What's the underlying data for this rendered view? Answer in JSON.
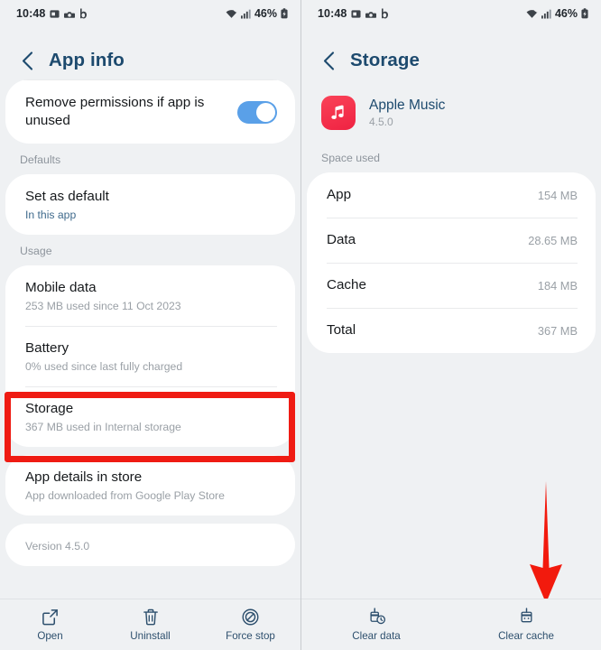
{
  "status_bar": {
    "time": "10:48",
    "left_icons": [
      "screenshot-icon",
      "camera-icon",
      "bixby-icon"
    ],
    "wifi_icon": "wifi-icon",
    "signal_icon": "signal-bars-icon",
    "battery_percent": "46%",
    "battery_icon": "battery-charging-icon"
  },
  "left_screen": {
    "title": "App info",
    "back_icon": "back-chevron-icon",
    "permissions": {
      "title": "Remove permissions if app is unused",
      "toggle_on": true
    },
    "defaults": {
      "label": "Defaults",
      "item": {
        "title": "Set as default",
        "subtitle": "In this app"
      }
    },
    "usage": {
      "label": "Usage",
      "items": [
        {
          "title": "Mobile data",
          "subtitle": "253 MB used since 11 Oct 2023"
        },
        {
          "title": "Battery",
          "subtitle": "0% used since last fully charged"
        },
        {
          "title": "Storage",
          "subtitle": "367 MB used in Internal storage",
          "highlighted": true
        }
      ]
    },
    "store": {
      "title": "App details in store",
      "subtitle": "App downloaded from Google Play Store"
    },
    "version": "Version 4.5.0",
    "toolbar": [
      {
        "label": "Open",
        "icon": "external-link-icon"
      },
      {
        "label": "Uninstall",
        "icon": "trash-icon"
      },
      {
        "label": "Force stop",
        "icon": "force-stop-icon"
      }
    ]
  },
  "right_screen": {
    "title": "Storage",
    "back_icon": "back-chevron-icon",
    "app": {
      "name": "Apple Music",
      "version": "4.5.0",
      "icon": "apple-music-icon"
    },
    "space_used": {
      "label": "Space used",
      "rows": [
        {
          "label": "App",
          "value": "154 MB"
        },
        {
          "label": "Data",
          "value": "28.65 MB"
        },
        {
          "label": "Cache",
          "value": "184 MB"
        },
        {
          "label": "Total",
          "value": "367 MB"
        }
      ]
    },
    "toolbar": [
      {
        "label": "Clear data",
        "icon": "clear-data-broom-icon"
      },
      {
        "label": "Clear cache",
        "icon": "clear-cache-broom-icon"
      }
    ]
  },
  "annotations": {
    "highlight_color": "#ef1b13",
    "box_target": "Storage",
    "arrow_target": "Clear cache"
  },
  "colors": {
    "accent_blue": "#1d4a6e",
    "toggle_on": "#5aa0e8",
    "app_icon_red": "#ef2242",
    "background": "#eff1f3",
    "card": "#ffffff"
  }
}
